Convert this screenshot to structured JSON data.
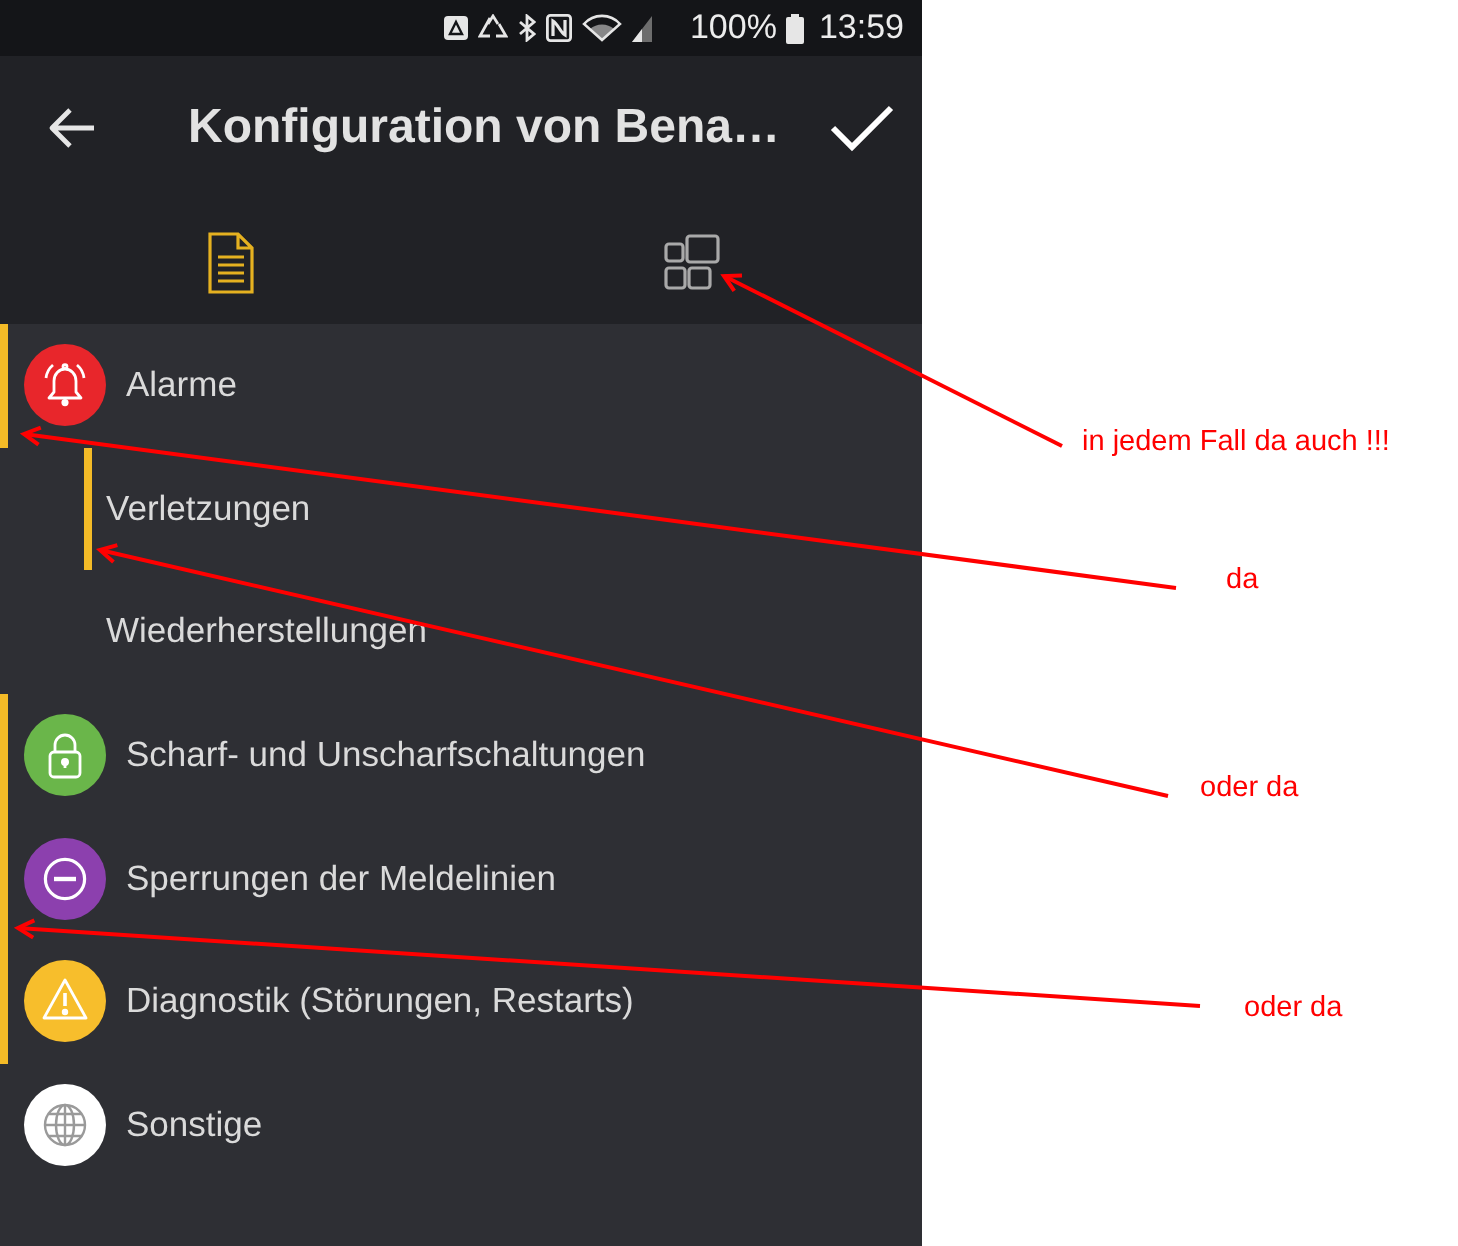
{
  "status_bar": {
    "battery": "100%",
    "time": "13:59"
  },
  "app_bar": {
    "title": "Konfiguration von Bena…"
  },
  "tabs": [
    {
      "selected": true
    },
    {
      "selected": false
    }
  ],
  "categories": [
    {
      "label": "Alarme",
      "color": "#e8262b",
      "marked": true,
      "children": [
        {
          "label": "Verletzungen",
          "marked": true
        },
        {
          "label": "Wiederherstellungen",
          "marked": false
        }
      ]
    },
    {
      "label": "Scharf- und Unscharfschaltungen",
      "color": "#6ab64a",
      "marked": true
    },
    {
      "label": "Sperrungen der Meldelinien",
      "color": "#8c40ae",
      "marked": true
    },
    {
      "label": "Diagnostik (Störungen, Restarts)",
      "color": "#f7be2c",
      "marked": true
    },
    {
      "label": "Sonstige",
      "color": "#ffffff",
      "marked": false
    }
  ],
  "annotations": [
    {
      "text": "in jedem Fall da auch !!!"
    },
    {
      "text": "da"
    },
    {
      "text": "oder da"
    },
    {
      "text": "oder da"
    }
  ]
}
